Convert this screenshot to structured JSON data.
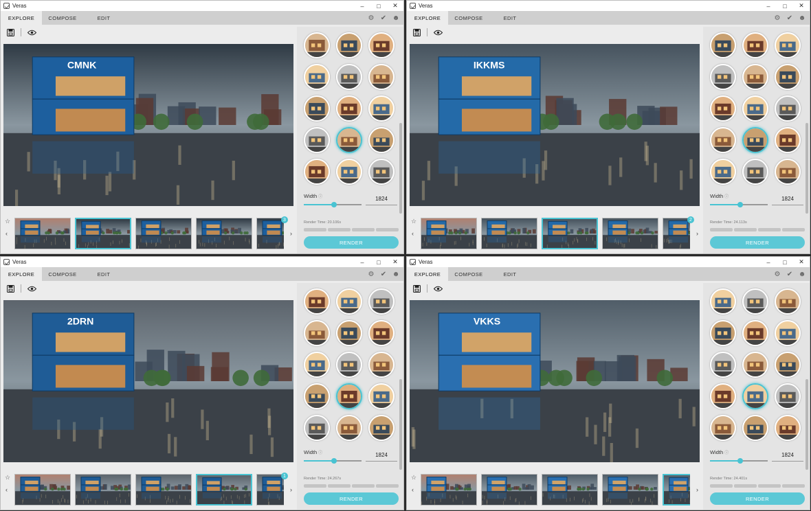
{
  "app": {
    "title": "Veras",
    "tabs": [
      "EXPLORE",
      "COMPOSE",
      "EDIT"
    ],
    "active_tab": "EXPLORE",
    "accent_color": "#49c3d2",
    "width_label": "Width",
    "render_label": "RENDER",
    "icons": {
      "settings": "gear-icon",
      "check": "check-icon",
      "user": "user-icon",
      "save": "save-icon",
      "preview": "eye-icon",
      "star": "star-icon",
      "prev": "chevron-left-icon",
      "next": "chevron-right-icon"
    }
  },
  "windows": [
    {
      "width_value": "1824",
      "width_slider": 0.52,
      "render_time": "Render Time: 20.106s",
      "thumb_count": "3",
      "selected_thumb": 1,
      "selected_style": 10,
      "sign_text": "CMNK",
      "sky": "#2f3a44",
      "container_color": "#1d5f9e",
      "scrollbar_color": "#b8b8b8"
    },
    {
      "width_value": "1824",
      "width_slider": 0.52,
      "render_time": "Render Time: 24.113s",
      "thumb_count": "2",
      "selected_thumb": 2,
      "selected_style": 10,
      "sign_text": "IKKMS",
      "sky": "#46535e",
      "container_color": "#246aa8",
      "scrollbar_color": "#b8b8b8"
    },
    {
      "width_value": "1824",
      "width_slider": 0.52,
      "render_time": "Render Time: 24.267s",
      "thumb_count": "1",
      "selected_thumb": 3,
      "selected_style": 10,
      "sign_text": "2DRN",
      "sky": "#5c646c",
      "container_color": "#1f5c96",
      "scrollbar_color": "#b8b8b8"
    },
    {
      "width_value": "1824",
      "width_slider": 0.52,
      "render_time": "Render Time: 24.401s",
      "thumb_count": "",
      "selected_thumb": 4,
      "selected_style": 10,
      "sign_text": "VKKS",
      "sky": "#505d68",
      "container_color": "#2a6fb0",
      "scrollbar_color": "#b8b8b8"
    }
  ]
}
